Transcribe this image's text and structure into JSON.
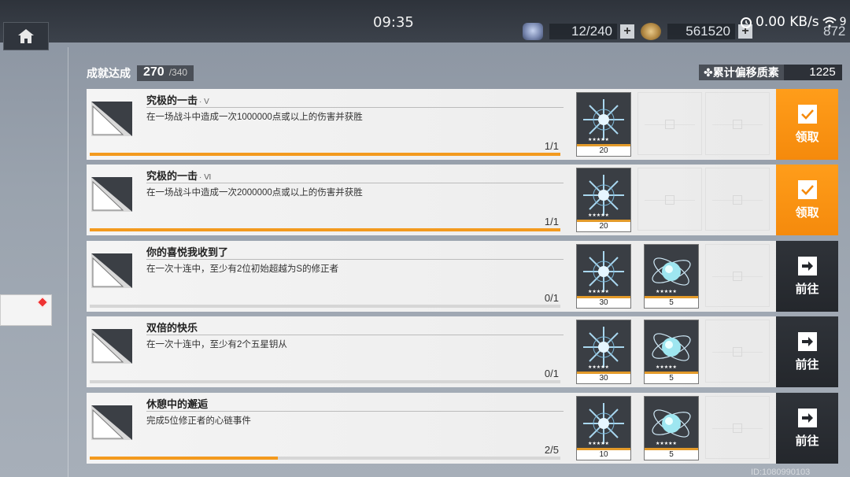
{
  "status_bar": {
    "clock": "09:35",
    "net_speed": "0.00 KB/s",
    "battery_fragment": "9"
  },
  "resources": {
    "stamina": "12/240",
    "currency": "561520",
    "third_fragment": "872"
  },
  "header": {
    "achievement_label": "成就达成",
    "achievement_current": "270",
    "achievement_total": "/340",
    "accum_label": "累计偏移质素",
    "accum_value": "1225"
  },
  "rows": [
    {
      "title": "究极的一击",
      "title_suffix": "· V",
      "desc": "在一场战斗中造成一次1000000点或以上的伤害并获胜",
      "progress": "1/1",
      "progress_fraction": 1.0,
      "rewards": [
        {
          "type": "star-item",
          "qty": "20"
        }
      ],
      "action": "claim",
      "action_label": "领取"
    },
    {
      "title": "究极的一击",
      "title_suffix": "· Ⅵ",
      "desc": "在一场战斗中造成一次2000000点或以上的伤害并获胜",
      "progress": "1/1",
      "progress_fraction": 1.0,
      "rewards": [
        {
          "type": "star-item",
          "qty": "20"
        }
      ],
      "action": "claim",
      "action_label": "领取"
    },
    {
      "title": "你的喜悦我收到了",
      "title_suffix": "",
      "desc": "在一次十连中，至少有2位初始超越为S的修正者",
      "progress": "0/1",
      "progress_fraction": 0.0,
      "rewards": [
        {
          "type": "star-item",
          "qty": "30"
        },
        {
          "type": "orb-item",
          "qty": "5"
        }
      ],
      "action": "goto",
      "action_label": "前往"
    },
    {
      "title": "双倍的快乐",
      "title_suffix": "",
      "desc": "在一次十连中，至少有2个五星钥从",
      "progress": "0/1",
      "progress_fraction": 0.0,
      "rewards": [
        {
          "type": "star-item",
          "qty": "30"
        },
        {
          "type": "orb-item",
          "qty": "5"
        }
      ],
      "action": "goto",
      "action_label": "前往"
    },
    {
      "title": "休憩中的邂逅",
      "title_suffix": "",
      "desc": "完成5位修正者的心链事件",
      "progress": "2/5",
      "progress_fraction": 0.4,
      "rewards": [
        {
          "type": "star-item",
          "qty": "10"
        },
        {
          "type": "orb-item",
          "qty": "5"
        }
      ],
      "action": "goto",
      "action_label": "前往"
    }
  ],
  "colors": {
    "accent_orange": "#f58a0c",
    "dark_button": "#2a2e33",
    "progress_fill": "#f39a1e"
  },
  "footer": {
    "id_text": "ID:1080990103"
  }
}
